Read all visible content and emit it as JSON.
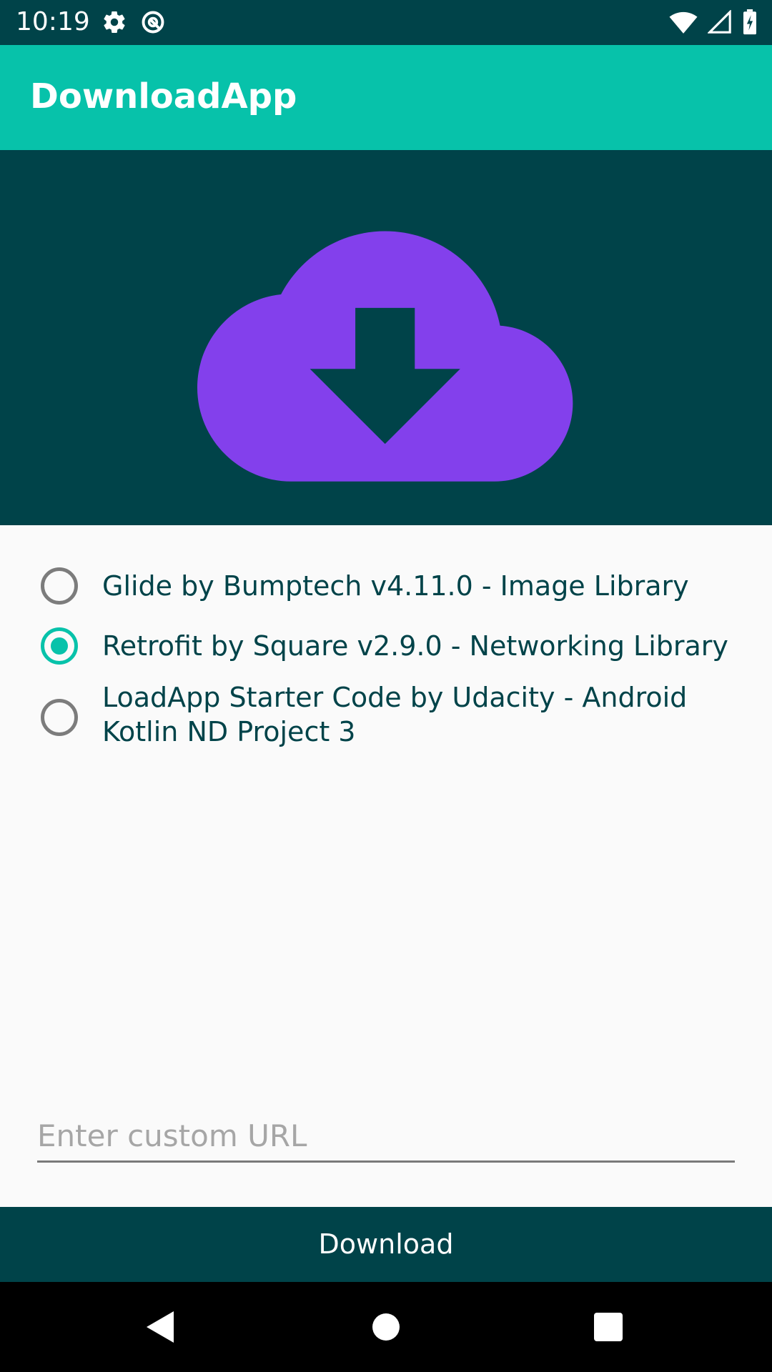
{
  "status_bar": {
    "time": "10:19",
    "icons_left": [
      "settings-icon",
      "data-saver-icon"
    ],
    "icons_right": [
      "wifi-icon",
      "signal-icon",
      "battery-charging-icon"
    ]
  },
  "app_bar": {
    "title": "DownloadApp"
  },
  "hero": {
    "icon": "cloud-download-icon",
    "icon_color": "#8340ec",
    "background": "#004349"
  },
  "options": [
    {
      "label": "Glide by Bumptech v4.11.0 - Image Library",
      "checked": false
    },
    {
      "label": "Retrofit by Square v2.9.0 - Networking Library",
      "checked": true
    },
    {
      "label": "LoadApp Starter Code by Udacity - Android Kotlin ND Project 3",
      "checked": false
    }
  ],
  "url_input": {
    "placeholder": "Enter custom URL",
    "value": ""
  },
  "download_button": {
    "label": "Download"
  },
  "nav_bar": {
    "buttons": [
      "back-icon",
      "home-icon",
      "recents-icon"
    ]
  },
  "colors": {
    "primary": "#07c2aa",
    "primary_dark": "#004349",
    "accent": "#8340ec"
  }
}
